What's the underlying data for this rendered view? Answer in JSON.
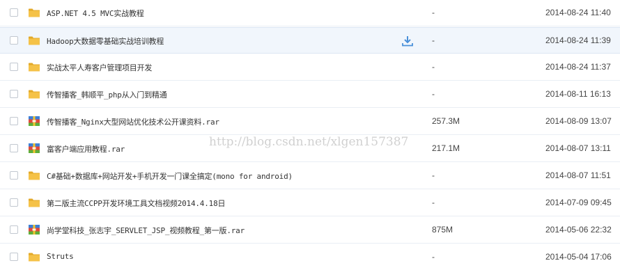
{
  "colors": {
    "folder": "#f5c248",
    "folder_dark": "#e3a929",
    "hover_row": "#f1f6fc",
    "download_icon": "#4a90d9",
    "watermark": "#787878"
  },
  "files": [
    {
      "name": "ASP.NET 4.5 MVC实战教程",
      "type": "folder",
      "icon": "folder-icon",
      "size": "-",
      "date": "2014-08-24 11:40"
    },
    {
      "name": "Hadoop大数据零基础实战培训教程",
      "type": "folder",
      "icon": "folder-icon",
      "size": "-",
      "date": "2014-08-24 11:39"
    },
    {
      "name": "实战太平人寿客户管理项目开发",
      "type": "folder",
      "icon": "folder-icon",
      "size": "-",
      "date": "2014-08-24 11:37"
    },
    {
      "name": "传智播客_韩顺平_php从入门到精通",
      "type": "folder",
      "icon": "folder-icon",
      "size": "-",
      "date": "2014-08-11 16:13"
    },
    {
      "name": "传智播客_Nginx大型网站优化技术公开课资料.rar",
      "type": "archive",
      "icon": "rar-archive-icon",
      "size": "257.3M",
      "date": "2014-08-09 13:07"
    },
    {
      "name": "富客户端应用教程.rar",
      "type": "archive",
      "icon": "rar-archive-icon",
      "size": "217.1M",
      "date": "2014-08-07 13:11"
    },
    {
      "name": "C#基础+数据库+网站开发+手机开发一门课全搞定(mono for android)",
      "type": "folder",
      "icon": "folder-icon",
      "size": "-",
      "date": "2014-08-07 11:51"
    },
    {
      "name": "第二版主流CCPP开发环境工具文档视频2014.4.18日",
      "type": "folder",
      "icon": "folder-icon",
      "size": "-",
      "date": "2014-07-09 09:45"
    },
    {
      "name": "尚学堂科技_张志宇_SERVLET_JSP_视频教程_第一版.rar",
      "type": "archive",
      "icon": "rar-archive-icon",
      "size": "875M",
      "date": "2014-05-06 22:32"
    },
    {
      "name": "Struts",
      "type": "folder",
      "icon": "folder-icon",
      "size": "-",
      "date": "2014-05-04 17:06"
    }
  ],
  "hover_row_index": 1,
  "download_icon": "download-icon",
  "watermark": "http://blog.csdn.net/xlgen157387"
}
